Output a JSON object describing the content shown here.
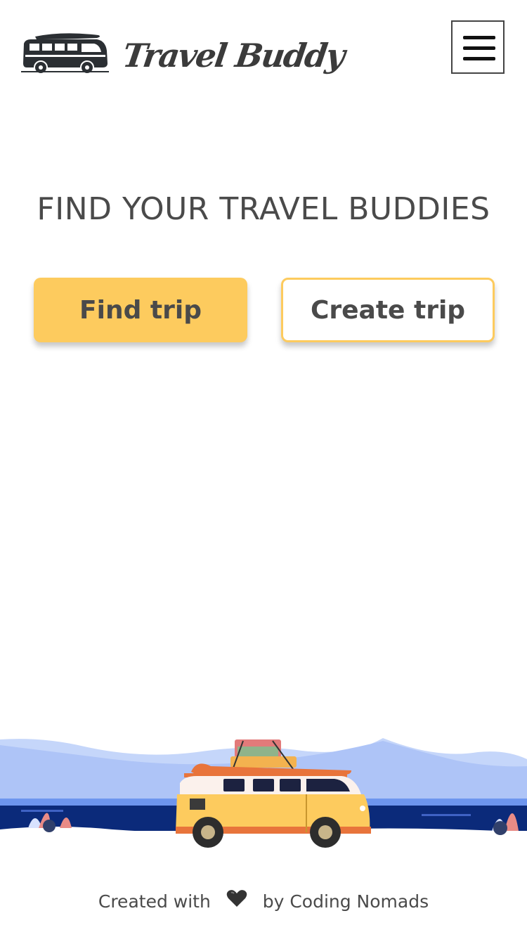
{
  "header": {
    "logo_text": "Travel Buddy",
    "menu_icon": "hamburger-menu-icon"
  },
  "hero": {
    "title": "FIND YOUR TRAVEL BUDDIES"
  },
  "actions": {
    "find_trip_label": "Find trip",
    "create_trip_label": "Create trip"
  },
  "footer": {
    "prefix": "Created with",
    "heart_icon": "heart-icon",
    "suffix": "by Coding Nomads"
  },
  "colors": {
    "accent": "#fdcb5e",
    "text": "#4a4a4a",
    "sky": "#b6c9f7",
    "sea": "#0b2a7a"
  }
}
